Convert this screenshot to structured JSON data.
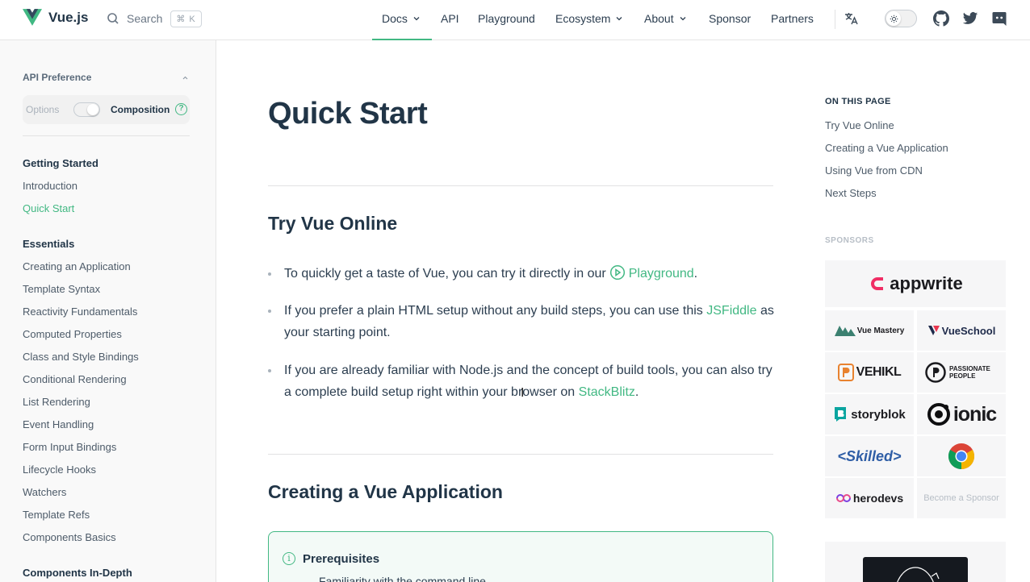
{
  "brand": {
    "name": "Vue.js",
    "color": "#42b883"
  },
  "search": {
    "label": "Search",
    "shortcut": "⌘ K"
  },
  "nav": {
    "docs": "Docs",
    "api": "API",
    "playground": "Playground",
    "ecosystem": "Ecosystem",
    "about": "About",
    "sponsor": "Sponsor",
    "partners": "Partners",
    "icons": [
      "translate-icon",
      "sun-icon",
      "github-icon",
      "twitter-icon",
      "discord-icon"
    ]
  },
  "preference": {
    "title": "API Preference",
    "options": "Options",
    "composition": "Composition",
    "help": "?"
  },
  "sidebar": {
    "groups": [
      {
        "title": "Getting Started",
        "items": [
          "Introduction",
          "Quick Start"
        ]
      },
      {
        "title": "Essentials",
        "items": [
          "Creating an Application",
          "Template Syntax",
          "Reactivity Fundamentals",
          "Computed Properties",
          "Class and Style Bindings",
          "Conditional Rendering",
          "List Rendering",
          "Event Handling",
          "Form Input Bindings",
          "Lifecycle Hooks",
          "Watchers",
          "Template Refs",
          "Components Basics"
        ]
      },
      {
        "title": "Components In-Depth",
        "items": []
      }
    ],
    "active": "Quick Start"
  },
  "main": {
    "title": "Quick Start",
    "section1": "Try Vue Online",
    "bullets": {
      "b1_pre": "To quickly get a taste of Vue, you can try it directly in our",
      "b1_link": "Playground",
      "b1_post": ".",
      "b2_pre": "If you prefer a plain HTML setup without any build steps, you can use this",
      "b2_link": "JSFiddle",
      "b2_post": "as your starting point.",
      "b3_pre": "If you are already familiar with Node.js and the concept of build tools, you can also try a complete build setup right within your browser on",
      "b3_link": "StackBlitz",
      "b3_post": "."
    },
    "section2": "Creating a Vue Application",
    "tip": {
      "title": "Prerequisites",
      "first_item": "Familiarity with the command line"
    }
  },
  "aside": {
    "on_this_page": "ON THIS PAGE",
    "items": [
      "Try Vue Online",
      "Creating a Vue Application",
      "Using Vue from CDN",
      "Next Steps"
    ],
    "sponsors_title": "SPONSORS",
    "sponsors": {
      "top": "appwrite",
      "vuemastery": "Vue Mastery",
      "vueschool": "VueSchool",
      "vehikl": "VEHIKL",
      "passionate": "PASSIONATE PEOPLE",
      "storyblok": "storyblok",
      "ionic": "ionic",
      "skilled": "<Skilled>",
      "herodevs": "herodevs",
      "become": "Become a Sponsor"
    }
  }
}
